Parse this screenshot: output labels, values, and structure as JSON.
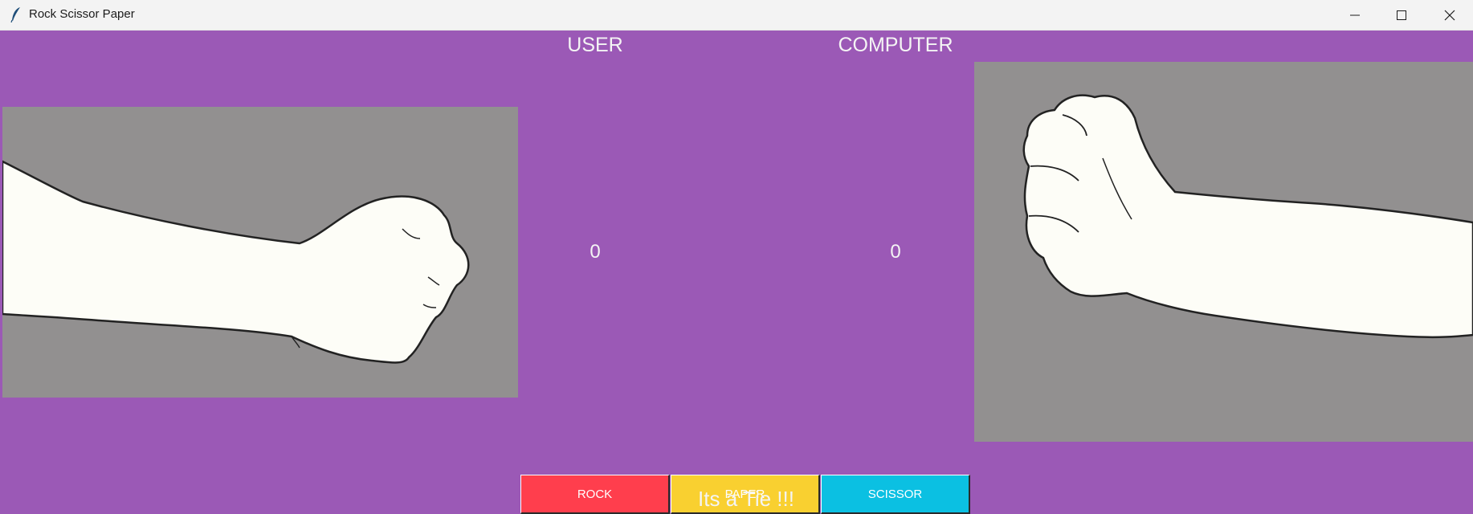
{
  "window": {
    "title": "Rock Scissor Paper",
    "icon": "feather-icon",
    "controls": [
      "minimize-icon",
      "maximize-icon",
      "close-icon"
    ]
  },
  "labels": {
    "user": "USER",
    "computer": "COMPUTER"
  },
  "scores": {
    "user": "0",
    "computer": "0"
  },
  "hands": {
    "user": "rock-hand-image",
    "computer": "rock-hand-image"
  },
  "buttons": [
    {
      "label": "ROCK",
      "color": "#ff3e4d"
    },
    {
      "label": "PAPER",
      "color": "#f9d030"
    },
    {
      "label": "SCISSOR",
      "color": "#0bc0e2"
    }
  ],
  "result": "Its a Tie !!!",
  "colors": {
    "background": "#9b59b6",
    "image_bg": "#929090"
  }
}
